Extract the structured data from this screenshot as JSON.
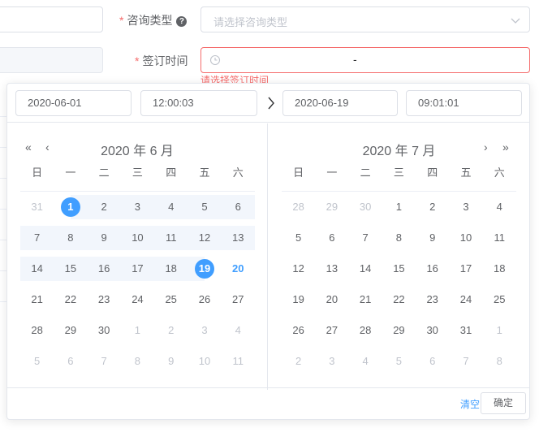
{
  "form": {
    "consult_type": {
      "label": "咨询类型",
      "required_mark": "*",
      "help_icon": "question-circle-icon",
      "help_glyph": "?",
      "placeholder": "请选择咨询类型",
      "dropdown_icon": "chevron-down-icon"
    },
    "sign_time": {
      "label": "签订时间",
      "required_mark": "*",
      "clock_icon": "clock-icon",
      "separator": "-",
      "error": "请选择签订时间"
    }
  },
  "picker": {
    "start_date": "2020-06-01",
    "start_time": "12:00:03",
    "end_date": "2020-06-19",
    "end_time": "09:01:01",
    "arrow_icon": "chevron-right-icon",
    "weekdays": [
      "日",
      "一",
      "二",
      "三",
      "四",
      "五",
      "六"
    ],
    "left": {
      "title": "2020 年 6 月",
      "prev_year": "«",
      "prev_month": "‹",
      "weeks": [
        [
          {
            "d": "31",
            "t": "other"
          },
          {
            "d": "1",
            "t": "sel-start"
          },
          {
            "d": "2",
            "t": "in"
          },
          {
            "d": "3",
            "t": "in"
          },
          {
            "d": "4",
            "t": "in"
          },
          {
            "d": "5",
            "t": "in"
          },
          {
            "d": "6",
            "t": "in"
          }
        ],
        [
          {
            "d": "7",
            "t": "in"
          },
          {
            "d": "8",
            "t": "in"
          },
          {
            "d": "9",
            "t": "in"
          },
          {
            "d": "10",
            "t": "in"
          },
          {
            "d": "11",
            "t": "in"
          },
          {
            "d": "12",
            "t": "in"
          },
          {
            "d": "13",
            "t": "in"
          }
        ],
        [
          {
            "d": "14",
            "t": "in"
          },
          {
            "d": "15",
            "t": "in"
          },
          {
            "d": "16",
            "t": "in"
          },
          {
            "d": "17",
            "t": "in"
          },
          {
            "d": "18",
            "t": "in"
          },
          {
            "d": "19",
            "t": "sel-end"
          },
          {
            "d": "20",
            "t": "today"
          }
        ],
        [
          {
            "d": "21",
            "t": ""
          },
          {
            "d": "22",
            "t": ""
          },
          {
            "d": "23",
            "t": ""
          },
          {
            "d": "24",
            "t": ""
          },
          {
            "d": "25",
            "t": ""
          },
          {
            "d": "26",
            "t": ""
          },
          {
            "d": "27",
            "t": ""
          }
        ],
        [
          {
            "d": "28",
            "t": ""
          },
          {
            "d": "29",
            "t": ""
          },
          {
            "d": "30",
            "t": ""
          },
          {
            "d": "1",
            "t": "other"
          },
          {
            "d": "2",
            "t": "other"
          },
          {
            "d": "3",
            "t": "other"
          },
          {
            "d": "4",
            "t": "other"
          }
        ],
        [
          {
            "d": "5",
            "t": "other"
          },
          {
            "d": "6",
            "t": "other"
          },
          {
            "d": "7",
            "t": "other"
          },
          {
            "d": "8",
            "t": "other"
          },
          {
            "d": "9",
            "t": "other"
          },
          {
            "d": "10",
            "t": "other"
          },
          {
            "d": "11",
            "t": "other"
          }
        ]
      ]
    },
    "right": {
      "title": "2020 年 7 月",
      "next_month": "›",
      "next_year": "»",
      "weeks": [
        [
          {
            "d": "28",
            "t": "other"
          },
          {
            "d": "29",
            "t": "other"
          },
          {
            "d": "30",
            "t": "other"
          },
          {
            "d": "1",
            "t": ""
          },
          {
            "d": "2",
            "t": ""
          },
          {
            "d": "3",
            "t": ""
          },
          {
            "d": "4",
            "t": ""
          }
        ],
        [
          {
            "d": "5",
            "t": ""
          },
          {
            "d": "6",
            "t": ""
          },
          {
            "d": "7",
            "t": ""
          },
          {
            "d": "8",
            "t": ""
          },
          {
            "d": "9",
            "t": ""
          },
          {
            "d": "10",
            "t": ""
          },
          {
            "d": "11",
            "t": ""
          }
        ],
        [
          {
            "d": "12",
            "t": ""
          },
          {
            "d": "13",
            "t": ""
          },
          {
            "d": "14",
            "t": ""
          },
          {
            "d": "15",
            "t": ""
          },
          {
            "d": "16",
            "t": ""
          },
          {
            "d": "17",
            "t": ""
          },
          {
            "d": "18",
            "t": ""
          }
        ],
        [
          {
            "d": "19",
            "t": ""
          },
          {
            "d": "20",
            "t": ""
          },
          {
            "d": "21",
            "t": ""
          },
          {
            "d": "22",
            "t": ""
          },
          {
            "d": "23",
            "t": ""
          },
          {
            "d": "24",
            "t": ""
          },
          {
            "d": "25",
            "t": ""
          }
        ],
        [
          {
            "d": "26",
            "t": ""
          },
          {
            "d": "27",
            "t": ""
          },
          {
            "d": "28",
            "t": ""
          },
          {
            "d": "29",
            "t": ""
          },
          {
            "d": "30",
            "t": ""
          },
          {
            "d": "31",
            "t": ""
          },
          {
            "d": "1",
            "t": "other"
          }
        ],
        [
          {
            "d": "2",
            "t": "other"
          },
          {
            "d": "3",
            "t": "other"
          },
          {
            "d": "4",
            "t": "other"
          },
          {
            "d": "5",
            "t": "other"
          },
          {
            "d": "6",
            "t": "other"
          },
          {
            "d": "7",
            "t": "other"
          },
          {
            "d": "8",
            "t": "other"
          }
        ]
      ]
    },
    "footer": {
      "clear": "清空",
      "confirm": "确定"
    }
  },
  "colors": {
    "primary": "#409eff",
    "error": "#f56c6c",
    "range_bg": "#f2f6fc",
    "muted": "#c0c4cc"
  }
}
